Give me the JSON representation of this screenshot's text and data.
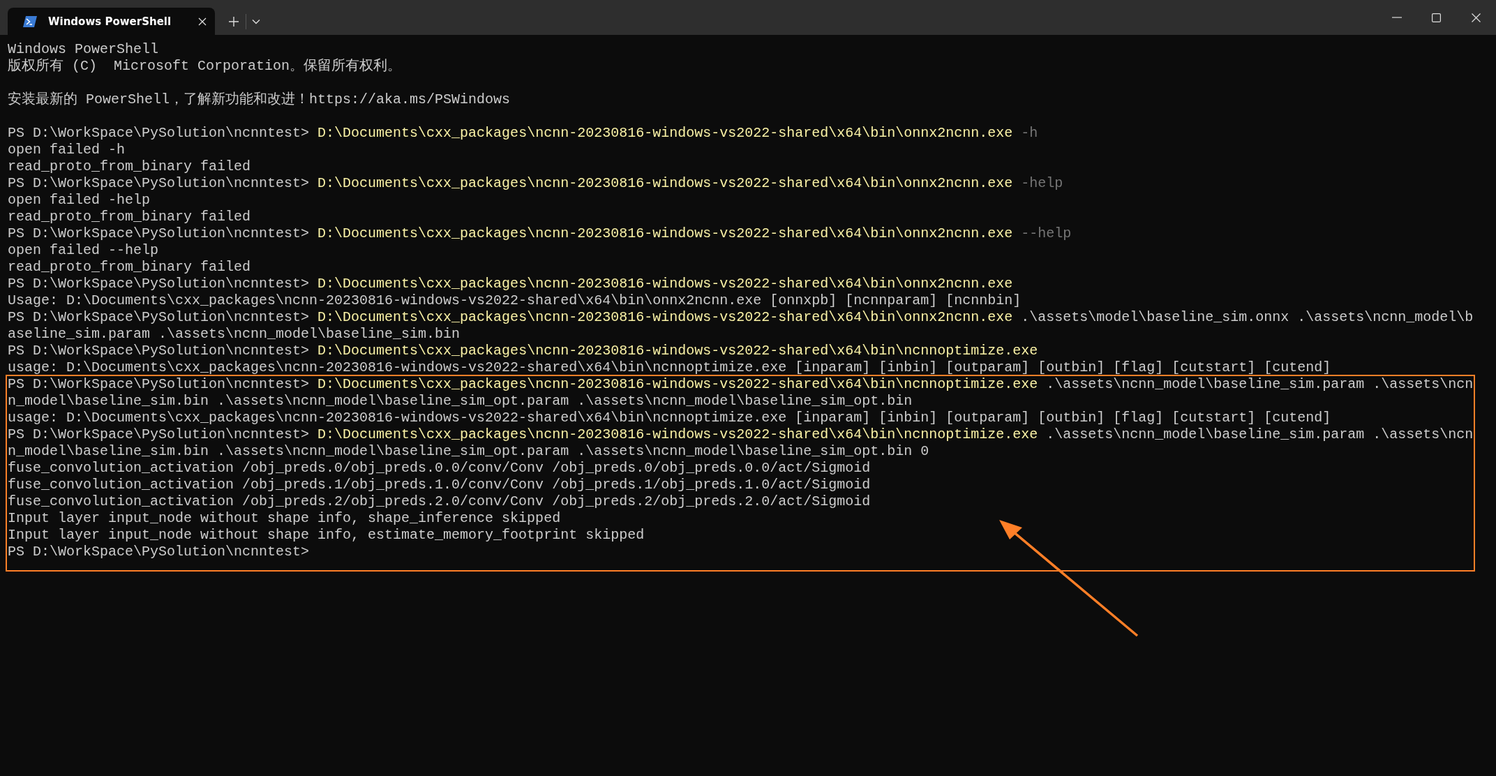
{
  "window": {
    "tab": {
      "title": "Windows PowerShell"
    }
  },
  "terminal": {
    "lines": [
      {
        "segments": [
          {
            "kind": "output",
            "text": "Windows PowerShell"
          }
        ]
      },
      {
        "segments": [
          {
            "kind": "output",
            "text": "版权所有 (C)  Microsoft Corporation。保留所有权利。"
          }
        ]
      },
      {
        "kind": "blank"
      },
      {
        "segments": [
          {
            "kind": "output",
            "text": "安装最新的 PowerShell，了解新功能和改进！https://aka.ms/PSWindows"
          }
        ]
      },
      {
        "kind": "blank"
      },
      {
        "segments": [
          {
            "kind": "prompt",
            "text": "PS D:\\WorkSpace\\PySolution\\ncnntest> "
          },
          {
            "kind": "command",
            "text": "D:\\Documents\\cxx_packages\\ncnn-20230816-windows-vs2022-shared\\x64\\bin\\onnx2ncnn.exe"
          },
          {
            "kind": "parameter",
            "text": " -h"
          }
        ]
      },
      {
        "segments": [
          {
            "kind": "output",
            "text": "open failed -h"
          }
        ]
      },
      {
        "segments": [
          {
            "kind": "output",
            "text": "read_proto_from_binary failed"
          }
        ]
      },
      {
        "segments": [
          {
            "kind": "prompt",
            "text": "PS D:\\WorkSpace\\PySolution\\ncnntest> "
          },
          {
            "kind": "command",
            "text": "D:\\Documents\\cxx_packages\\ncnn-20230816-windows-vs2022-shared\\x64\\bin\\onnx2ncnn.exe"
          },
          {
            "kind": "parameter",
            "text": " -help"
          }
        ]
      },
      {
        "segments": [
          {
            "kind": "output",
            "text": "open failed -help"
          }
        ]
      },
      {
        "segments": [
          {
            "kind": "output",
            "text": "read_proto_from_binary failed"
          }
        ]
      },
      {
        "segments": [
          {
            "kind": "prompt",
            "text": "PS D:\\WorkSpace\\PySolution\\ncnntest> "
          },
          {
            "kind": "command",
            "text": "D:\\Documents\\cxx_packages\\ncnn-20230816-windows-vs2022-shared\\x64\\bin\\onnx2ncnn.exe"
          },
          {
            "kind": "parameter",
            "text": " --help"
          }
        ]
      },
      {
        "segments": [
          {
            "kind": "output",
            "text": "open failed --help"
          }
        ]
      },
      {
        "segments": [
          {
            "kind": "output",
            "text": "read_proto_from_binary failed"
          }
        ]
      },
      {
        "segments": [
          {
            "kind": "prompt",
            "text": "PS D:\\WorkSpace\\PySolution\\ncnntest> "
          },
          {
            "kind": "command",
            "text": "D:\\Documents\\cxx_packages\\ncnn-20230816-windows-vs2022-shared\\x64\\bin\\onnx2ncnn.exe"
          }
        ]
      },
      {
        "segments": [
          {
            "kind": "output",
            "text": "Usage: D:\\Documents\\cxx_packages\\ncnn-20230816-windows-vs2022-shared\\x64\\bin\\onnx2ncnn.exe [onnxpb] [ncnnparam] [ncnnbin]"
          }
        ]
      },
      {
        "segments": [
          {
            "kind": "prompt",
            "text": "PS D:\\WorkSpace\\PySolution\\ncnntest> "
          },
          {
            "kind": "command",
            "text": "D:\\Documents\\cxx_packages\\ncnn-20230816-windows-vs2022-shared\\x64\\bin\\onnx2ncnn.exe"
          },
          {
            "kind": "argument",
            "text": " .\\assets\\model\\baseline_sim.onnx .\\assets\\ncnn_model\\b"
          }
        ]
      },
      {
        "segments": [
          {
            "kind": "argument",
            "text": "aseline_sim.param .\\assets\\ncnn_model\\baseline_sim.bin"
          }
        ]
      },
      {
        "segments": [
          {
            "kind": "prompt",
            "text": "PS D:\\WorkSpace\\PySolution\\ncnntest> "
          },
          {
            "kind": "command",
            "text": "D:\\Documents\\cxx_packages\\ncnn-20230816-windows-vs2022-shared\\x64\\bin\\ncnnoptimize.exe"
          }
        ]
      },
      {
        "segments": [
          {
            "kind": "output",
            "text": "usage: D:\\Documents\\cxx_packages\\ncnn-20230816-windows-vs2022-shared\\x64\\bin\\ncnnoptimize.exe [inparam] [inbin] [outparam] [outbin] [flag] [cutstart] [cutend]"
          }
        ]
      }
    ],
    "highlighted_block": {
      "lines": [
        {
          "segments": [
            {
              "kind": "prompt",
              "text": "PS D:\\WorkSpace\\PySolution\\ncnntest> "
            },
            {
              "kind": "command",
              "text": "D:\\Documents\\cxx_packages\\ncnn-20230816-windows-vs2022-shared\\x64\\bin\\ncnnoptimize.exe"
            },
            {
              "kind": "argument",
              "text": " .\\assets\\ncnn_model\\baseline_sim.param .\\assets\\ncn"
            }
          ]
        },
        {
          "segments": [
            {
              "kind": "argument",
              "text": "n_model\\baseline_sim.bin .\\assets\\ncnn_model\\baseline_sim_opt.param .\\assets\\ncnn_model\\baseline_sim_opt.bin"
            }
          ]
        },
        {
          "segments": [
            {
              "kind": "output",
              "text": "usage: D:\\Documents\\cxx_packages\\ncnn-20230816-windows-vs2022-shared\\x64\\bin\\ncnnoptimize.exe [inparam] [inbin] [outparam] [outbin] [flag] [cutstart] [cutend]"
            }
          ]
        },
        {
          "segments": [
            {
              "kind": "prompt",
              "text": "PS D:\\WorkSpace\\PySolution\\ncnntest> "
            },
            {
              "kind": "command",
              "text": "D:\\Documents\\cxx_packages\\ncnn-20230816-windows-vs2022-shared\\x64\\bin\\ncnnoptimize.exe"
            },
            {
              "kind": "argument",
              "text": " .\\assets\\ncnn_model\\baseline_sim.param .\\assets\\ncn"
            }
          ]
        },
        {
          "segments": [
            {
              "kind": "argument",
              "text": "n_model\\baseline_sim.bin .\\assets\\ncnn_model\\baseline_sim_opt.param .\\assets\\ncnn_model\\baseline_sim_opt.bin 0"
            }
          ]
        },
        {
          "segments": [
            {
              "kind": "output",
              "text": "fuse_convolution_activation /obj_preds.0/obj_preds.0.0/conv/Conv /obj_preds.0/obj_preds.0.0/act/Sigmoid"
            }
          ]
        },
        {
          "segments": [
            {
              "kind": "output",
              "text": "fuse_convolution_activation /obj_preds.1/obj_preds.1.0/conv/Conv /obj_preds.1/obj_preds.1.0/act/Sigmoid"
            }
          ]
        },
        {
          "segments": [
            {
              "kind": "output",
              "text": "fuse_convolution_activation /obj_preds.2/obj_preds.2.0/conv/Conv /obj_preds.2/obj_preds.2.0/act/Sigmoid"
            }
          ]
        },
        {
          "segments": [
            {
              "kind": "output",
              "text": "Input layer input_node without shape info, shape_inference skipped"
            }
          ]
        },
        {
          "segments": [
            {
              "kind": "output",
              "text": "Input layer input_node without shape info, estimate_memory_footprint skipped"
            }
          ]
        },
        {
          "segments": [
            {
              "kind": "prompt",
              "text": "PS D:\\WorkSpace\\PySolution\\ncnntest>"
            }
          ]
        }
      ]
    }
  }
}
